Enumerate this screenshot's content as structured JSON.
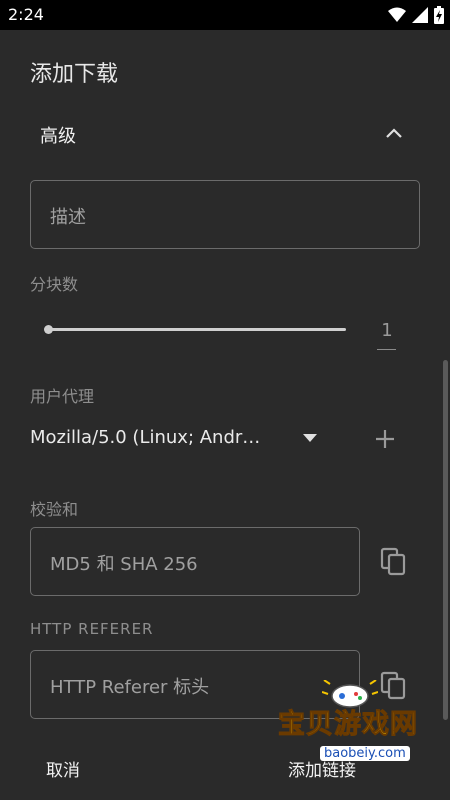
{
  "status_bar": {
    "time": "2:24",
    "icons": [
      "wifi-icon",
      "signal-icon",
      "battery-charging-icon"
    ]
  },
  "dialog": {
    "title": "添加下载",
    "advanced": {
      "label": "高级",
      "expanded": true
    },
    "description": {
      "placeholder": "描述"
    },
    "pieces": {
      "label": "分块数",
      "value": "1"
    },
    "user_agent": {
      "label": "用户代理",
      "value": "Mozilla/5.0 (Linux; Andr…"
    },
    "checksum": {
      "label": "校验和",
      "placeholder": "MD5 和 SHA 256"
    },
    "referer": {
      "label": "HTTP REFERER",
      "placeholder": "HTTP Referer 标头"
    },
    "buttons": {
      "cancel": "取消",
      "add": "添加链接"
    }
  },
  "watermark": {
    "text": "宝贝游戏网",
    "url": "baobeiy.com"
  },
  "colors": {
    "dialog_bg": "#2a2a2a",
    "status_bg": "#000000",
    "outline": "#6b6b6b",
    "watermark": "#f5c500"
  }
}
